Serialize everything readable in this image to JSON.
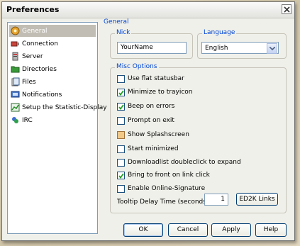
{
  "window": {
    "title": "Preferences"
  },
  "sidebar": {
    "items": [
      {
        "label": "General",
        "icon": "general-icon",
        "selected": true
      },
      {
        "label": "Connection",
        "icon": "connection-icon",
        "selected": false
      },
      {
        "label": "Server",
        "icon": "server-icon",
        "selected": false
      },
      {
        "label": "Directories",
        "icon": "directories-icon",
        "selected": false
      },
      {
        "label": "Files",
        "icon": "files-icon",
        "selected": false
      },
      {
        "label": "Notifications",
        "icon": "notifications-icon",
        "selected": false
      },
      {
        "label": "Setup the Statistic-Display",
        "icon": "statistics-icon",
        "selected": false
      },
      {
        "label": "IRC",
        "icon": "irc-icon",
        "selected": false
      }
    ]
  },
  "panel": {
    "title": "General"
  },
  "nick": {
    "group_label": "Nick",
    "value": "YourName"
  },
  "language": {
    "group_label": "Language",
    "value": "English"
  },
  "misc": {
    "group_label": "Misc Options",
    "options": [
      {
        "label": "Use flat statusbar",
        "checked": false
      },
      {
        "label": "Minimize to trayicon",
        "checked": true
      },
      {
        "label": "Beep on errors",
        "checked": true
      },
      {
        "label": "Prompt on exit",
        "checked": false
      },
      {
        "label": "Show Splashscreen",
        "checked": false
      },
      {
        "label": "Start minimized",
        "checked": false
      },
      {
        "label": "Downloadlist doubleclick to expand",
        "checked": false
      },
      {
        "label": "Bring to front on link click",
        "checked": true
      },
      {
        "label": "Enable Online-Signature",
        "checked": false
      }
    ],
    "tooltip_label": "Tooltip Delay Time (seconds)",
    "tooltip_value": "1",
    "ed2k_button": "ED2K Links"
  },
  "buttons": {
    "ok": "OK",
    "cancel": "Cancel",
    "apply": "Apply",
    "help": "Help"
  }
}
